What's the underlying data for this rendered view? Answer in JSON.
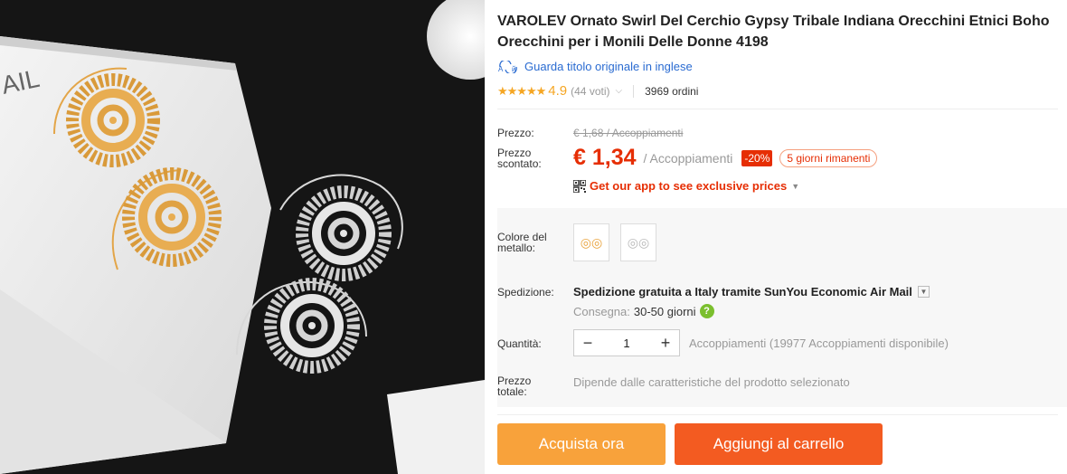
{
  "product": {
    "title": "VAROLEV Ornato Swirl Del Cerchio Gypsy Tribale Indiana Orecchini Etnici Boho Orecchini per i Monili Delle Donne 4198",
    "original_title_link": "Guarda titolo originale in inglese",
    "rating": {
      "stars": "★★★★★",
      "score": "4.9",
      "votes": "(44 voti)",
      "orders": "3969 ordini"
    }
  },
  "price": {
    "label": "Prezzo:",
    "original": "€ 1,68 / Accoppiamenti",
    "discount_label": "Prezzo scontato:",
    "discounted": "€ 1,34",
    "unit": "/ Accoppiamenti",
    "discount_badge": "-20%",
    "days_left": "5 giorni rimanenti",
    "app_promo": "Get our app to see exclusive prices"
  },
  "options": {
    "color_label": "Colore del metallo:",
    "swatches": [
      {
        "name": "gold",
        "color": "#e9a23b"
      },
      {
        "name": "silver",
        "color": "#b8b8b8"
      }
    ]
  },
  "shipping": {
    "label": "Spedizione:",
    "method": "Spedizione gratuita a Italy tramite SunYou Economic Air Mail",
    "delivery_label": "Consegna:",
    "delivery_value": "30-50 giorni"
  },
  "quantity": {
    "label": "Quantità:",
    "value": "1",
    "minus": "−",
    "plus": "+",
    "note": "Accoppiamenti (19977 Accoppiamenti disponibile)"
  },
  "total": {
    "label": "Prezzo totale:",
    "note": "Dipende dalle caratteristiche del prodotto selezionato"
  },
  "actions": {
    "buy_now": "Acquista ora",
    "add_to_cart": "Aggiungi al carrello"
  },
  "image": {
    "card_text": "AIL"
  },
  "colors": {
    "accent": "#e62e04",
    "buy": "#f8a23b",
    "cart": "#f35b21",
    "link": "#2a6bd1"
  }
}
